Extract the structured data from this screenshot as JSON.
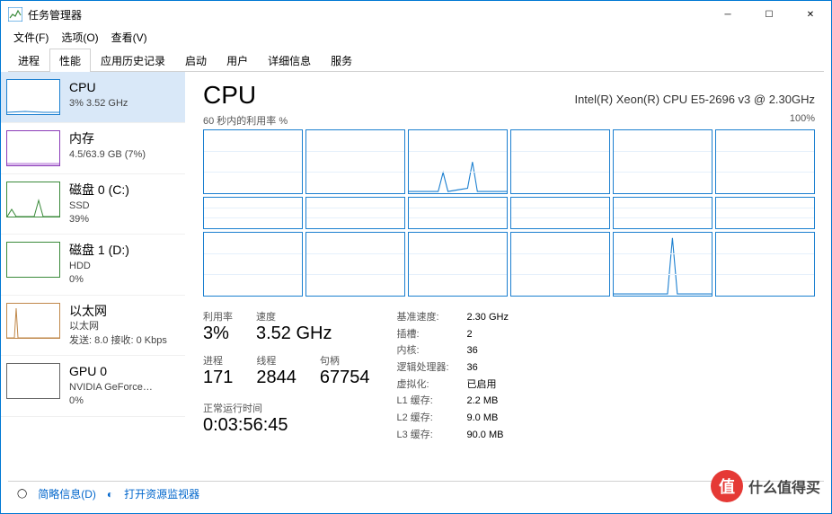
{
  "window": {
    "title": "任务管理器"
  },
  "menu": {
    "file": "文件(F)",
    "options": "选项(O)",
    "view": "查看(V)"
  },
  "tabs": {
    "items": [
      "进程",
      "性能",
      "应用历史记录",
      "启动",
      "用户",
      "详细信息",
      "服务"
    ],
    "activeIndex": 1
  },
  "sidebar": {
    "items": [
      {
        "name": "CPU",
        "sub": "3% 3.52 GHz",
        "type": "cpu"
      },
      {
        "name": "内存",
        "sub": "4.5/63.9 GB (7%)",
        "type": "mem"
      },
      {
        "name": "磁盘 0 (C:)",
        "sub1": "SSD",
        "sub2": "39%",
        "type": "disk"
      },
      {
        "name": "磁盘 1 (D:)",
        "sub1": "HDD",
        "sub2": "0%",
        "type": "disk"
      },
      {
        "name": "以太网",
        "sub1": "以太网",
        "sub2": "发送: 8.0 接收: 0 Kbps",
        "type": "eth"
      },
      {
        "name": "GPU 0",
        "sub1": "NVIDIA GeForce…",
        "sub2": "0%",
        "type": "gpu"
      }
    ]
  },
  "detail": {
    "title": "CPU",
    "model": "Intel(R) Xeon(R) CPU E5-2696 v3 @ 2.30GHz",
    "graphLabelLeft": "60 秒内的利用率 %",
    "graphLabelRight": "100%",
    "m": {
      "utilLabel": "利用率",
      "util": "3%",
      "speedLabel": "速度",
      "speed": "3.52 GHz",
      "procLabel": "进程",
      "proc": "171",
      "threadLabel": "线程",
      "thread": "2844",
      "handleLabel": "句柄",
      "handle": "67754",
      "uptimeLabel": "正常运行时间",
      "uptime": "0:03:56:45"
    },
    "specs": {
      "baseLabel": "基准速度:",
      "base": "2.30 GHz",
      "socketLabel": "插槽:",
      "socket": "2",
      "coresLabel": "内核:",
      "cores": "36",
      "lpLabel": "逻辑处理器:",
      "lp": "36",
      "virtLabel": "虚拟化:",
      "virt": "已启用",
      "l1Label": "L1 缓存:",
      "l1": "2.2 MB",
      "l2Label": "L2 缓存:",
      "l2": "9.0 MB",
      "l3Label": "L3 缓存:",
      "l3": "90.0 MB"
    }
  },
  "footer": {
    "less": "简略信息(D)",
    "resmon": "打开资源监视器"
  },
  "watermark": {
    "text": "什么值得买",
    "badge": "值"
  }
}
